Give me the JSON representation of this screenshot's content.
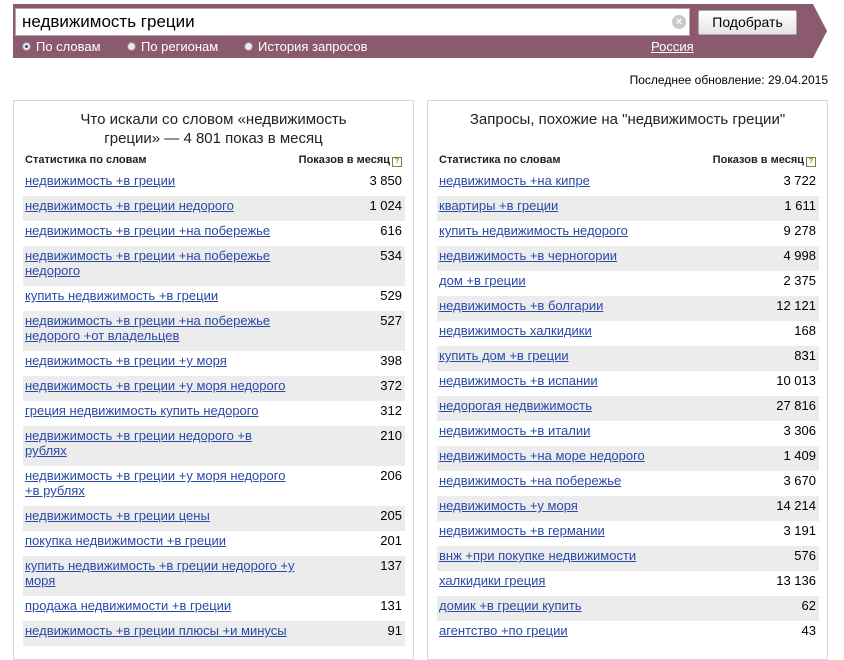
{
  "search": {
    "query": "недвижимость греции",
    "submit_label": "Подобрать",
    "region": "Россия",
    "modes": [
      {
        "label": "По словам",
        "selected": true
      },
      {
        "label": "По регионам",
        "selected": false
      },
      {
        "label": "История запросов",
        "selected": false
      }
    ]
  },
  "updated_label": "Последнее обновление: 29.04.2015",
  "left_panel": {
    "title": "Что искали со словом «недвижимость греции» — 4 801 показ в месяц",
    "col_query": "Статистика по словам",
    "col_count": "Показов в месяц",
    "rows": [
      {
        "query": "недвижимость +в греции",
        "count": "3 850"
      },
      {
        "query": "недвижимость +в греции недорого",
        "count": "1 024"
      },
      {
        "query": "недвижимость +в греции +на побережье",
        "count": "616"
      },
      {
        "query": "недвижимость +в греции +на побережье недорого",
        "count": "534"
      },
      {
        "query": "купить недвижимость +в греции",
        "count": "529"
      },
      {
        "query": "недвижимость +в греции +на побережье недорого +от владельцев",
        "count": "527"
      },
      {
        "query": "недвижимость +в греции +у моря",
        "count": "398"
      },
      {
        "query": "недвижимость +в греции +у моря недорого",
        "count": "372"
      },
      {
        "query": "греция недвижимость купить недорого",
        "count": "312"
      },
      {
        "query": "недвижимость +в греции недорого +в рублях",
        "count": "210"
      },
      {
        "query": "недвижимость +в греции +у моря недорого +в рублях",
        "count": "206"
      },
      {
        "query": "недвижимость +в греции цены",
        "count": "205"
      },
      {
        "query": "покупка недвижимости +в греции",
        "count": "201"
      },
      {
        "query": "купить недвижимость +в греции недорого +у моря",
        "count": "137"
      },
      {
        "query": "продажа недвижимости +в греции",
        "count": "131"
      },
      {
        "query": "недвижимость +в греции плюсы +и минусы",
        "count": "91"
      }
    ]
  },
  "right_panel": {
    "title": "Запросы, похожие на \"недвижимость греции\"",
    "col_query": "Статистика по словам",
    "col_count": "Показов в месяц",
    "rows": [
      {
        "query": "недвижимость +на кипре",
        "count": "3 722"
      },
      {
        "query": "квартиры +в греции",
        "count": "1 611"
      },
      {
        "query": "купить недвижимость недорого",
        "count": "9 278"
      },
      {
        "query": "недвижимость +в черногории",
        "count": "4 998"
      },
      {
        "query": "дом +в греции",
        "count": "2 375"
      },
      {
        "query": "недвижимость +в болгарии",
        "count": "12 121"
      },
      {
        "query": "недвижимость халкидики",
        "count": "168"
      },
      {
        "query": "купить дом +в греции",
        "count": "831"
      },
      {
        "query": "недвижимость +в испании",
        "count": "10 013"
      },
      {
        "query": "недорогая недвижимость",
        "count": "27 816"
      },
      {
        "query": "недвижимость +в италии",
        "count": "3 306"
      },
      {
        "query": "недвижимость +на море недорого",
        "count": "1 409"
      },
      {
        "query": "недвижимость +на побережье",
        "count": "3 670"
      },
      {
        "query": "недвижимость +у моря",
        "count": "14 214"
      },
      {
        "query": "недвижимость +в германии",
        "count": "3 191"
      },
      {
        "query": "внж +при покупке недвижимости",
        "count": "576"
      },
      {
        "query": "халкидики греция",
        "count": "13 136"
      },
      {
        "query": "домик +в греции купить",
        "count": "62"
      },
      {
        "query": "агентство +по греции",
        "count": "43"
      }
    ]
  }
}
